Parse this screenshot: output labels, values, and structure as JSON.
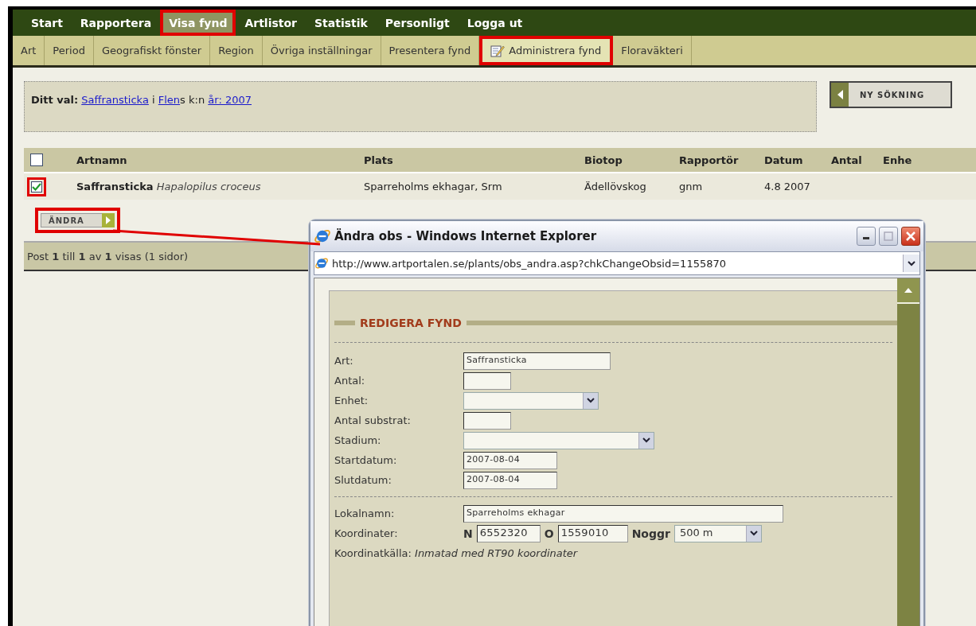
{
  "main_nav": [
    {
      "label": "Start",
      "selected": false,
      "highlighted": false
    },
    {
      "label": "Rapportera",
      "selected": false,
      "highlighted": false
    },
    {
      "label": "Visa fynd",
      "selected": true,
      "highlighted": true
    },
    {
      "label": "Artlistor",
      "selected": false,
      "highlighted": false
    },
    {
      "label": "Statistik",
      "selected": false,
      "highlighted": false
    },
    {
      "label": "Personligt",
      "selected": false,
      "highlighted": false
    },
    {
      "label": "Logga ut",
      "selected": false,
      "highlighted": false
    }
  ],
  "sub_nav": [
    {
      "label": "Art",
      "selected": false,
      "highlighted": false
    },
    {
      "label": "Period",
      "selected": false,
      "highlighted": false
    },
    {
      "label": "Geografiskt fönster",
      "selected": false,
      "highlighted": false
    },
    {
      "label": "Region",
      "selected": false,
      "highlighted": false
    },
    {
      "label": "Övriga inställningar",
      "selected": false,
      "highlighted": false
    },
    {
      "label": "Presentera fynd",
      "selected": false,
      "highlighted": false
    },
    {
      "label": "Administrera fynd",
      "selected": true,
      "highlighted": true
    },
    {
      "label": "Floraväkteri",
      "selected": false,
      "highlighted": false
    }
  ],
  "selection": {
    "label": "Ditt val:",
    "parts": [
      {
        "kind": "link",
        "text": "Saffransticka",
        "attached": false
      },
      {
        "kind": "text",
        "text": "i",
        "attached": false
      },
      {
        "kind": "link",
        "text": "Flen",
        "attached": false
      },
      {
        "kind": "text",
        "text": "s k:n",
        "attached": true
      },
      {
        "kind": "link",
        "text": "år: 2007",
        "attached": false
      }
    ]
  },
  "new_search_button": "NY SÖKNING",
  "table": {
    "all_checked": false,
    "columns": [
      "Artnamn",
      "Plats",
      "Biotop",
      "Rapportör",
      "Datum",
      "Antal",
      "Enhe"
    ],
    "rows": [
      {
        "checked": true,
        "highlighted": true,
        "cells": [
          "**Saffransticka** *Hapalopilus croceus*",
          "Sparreholms ekhagar, Srm",
          "Ädellövskog",
          "gnm",
          "4.8 2007"
        ]
      }
    ]
  },
  "edit_button": {
    "label": "ÄNDRA",
    "highlighted": true
  },
  "pager": "Post **1** till **1** av **1** visas (1 sidor)",
  "popup": {
    "title": "Ändra obs - Windows Internet Explorer",
    "url": "http://www.artportalen.se/plants/obs_andra.asp?chkChangeObsid=1155870",
    "heading": "REDIGERA FYND",
    "sections": [
      {
        "fields": [
          {
            "kind": "text",
            "label": "Art:",
            "value": "Saffransticka"
          },
          {
            "kind": "text",
            "label": "Antal:"
          },
          {
            "kind": "select",
            "label": "Enhet:"
          },
          {
            "kind": "text",
            "label": "Antal substrat:"
          },
          {
            "kind": "select",
            "label": "Stadium:"
          },
          {
            "kind": "text",
            "label": "Startdatum:",
            "value": "2007-08-04"
          },
          {
            "kind": "text",
            "label": "Slutdatum:",
            "value": "2007-08-04"
          }
        ]
      },
      {
        "fields": [
          {
            "kind": "text",
            "label": "Lokalnamn:",
            "value": "Sparreholms ekhagar"
          },
          {
            "kind": "coords",
            "label": "Koordinater:",
            "north_label": "N",
            "north": "6552320",
            "east_label": "O",
            "east": "1559010",
            "accuracy_label": "Noggr",
            "accuracy": "500 m"
          },
          {
            "kind": "info",
            "label": "Koordinatkälla:",
            "value": "Inmatad med RT90 koordinater"
          }
        ]
      }
    ]
  }
}
